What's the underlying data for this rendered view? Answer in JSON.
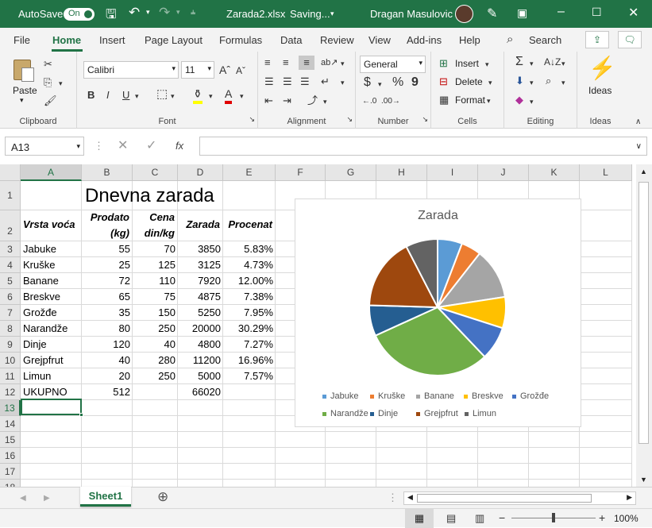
{
  "titlebar": {
    "autosave": "AutoSave",
    "toggle": "On",
    "filename": "Zarada2.xlsx",
    "status": "Saving...",
    "user": "Dragan Masulovic"
  },
  "tabs": [
    "File",
    "Home",
    "Insert",
    "Page Layout",
    "Formulas",
    "Data",
    "Review",
    "View",
    "Add-ins",
    "Help"
  ],
  "search": "Search",
  "ribbon": {
    "clipboard": {
      "paste": "Paste",
      "label": "Clipboard"
    },
    "font": {
      "name": "Calibri",
      "size": "11",
      "label": "Font",
      "grow": "A^",
      "shrink": "Aˇ",
      "bold": "B",
      "italic": "I",
      "underline": "U"
    },
    "alignment": {
      "label": "Alignment"
    },
    "number": {
      "format": "General",
      "label": "Number",
      "currency": "$",
      "percent": "%",
      "comma": "9"
    },
    "cells": {
      "insert": "Insert",
      "delete": "Delete",
      "format": "Format",
      "label": "Cells"
    },
    "editing": {
      "label": "Editing"
    },
    "ideas": {
      "btn": "Ideas",
      "label": "Ideas"
    }
  },
  "formula": {
    "namebox": "A13",
    "fx": "fx",
    "value": ""
  },
  "columns": [
    "A",
    "B",
    "C",
    "D",
    "E",
    "F",
    "G",
    "H",
    "I",
    "J",
    "K",
    "L"
  ],
  "rows": [
    "1",
    "2",
    "3",
    "4",
    "5",
    "6",
    "7",
    "8",
    "9",
    "10",
    "11",
    "12",
    "13",
    "14",
    "15",
    "16",
    "17",
    "18"
  ],
  "sheet": {
    "title": "Dnevna zarada",
    "headers": {
      "a": "Vrsta voća",
      "b1": "Prodato",
      "b2": "(kg)",
      "c1": "Cena",
      "c2": "din/kg",
      "d": "Zarada",
      "e": "Procenat"
    },
    "data": [
      [
        "Jabuke",
        "55",
        "70",
        "3850",
        "5.83%"
      ],
      [
        "Kruške",
        "25",
        "125",
        "3125",
        "4.73%"
      ],
      [
        "Banane",
        "72",
        "110",
        "7920",
        "12.00%"
      ],
      [
        "Breskve",
        "65",
        "75",
        "4875",
        "7.38%"
      ],
      [
        "Grožđe",
        "35",
        "150",
        "5250",
        "7.95%"
      ],
      [
        "Narandže",
        "80",
        "250",
        "20000",
        "30.29%"
      ],
      [
        "Dinje",
        "120",
        "40",
        "4800",
        "7.27%"
      ],
      [
        "Grejpfrut",
        "40",
        "280",
        "11200",
        "16.96%"
      ],
      [
        "Limun",
        "20",
        "250",
        "5000",
        "7.57%"
      ]
    ],
    "total": [
      "UKUPNO",
      "512",
      "",
      "66020",
      ""
    ]
  },
  "sheet_tab": "Sheet1",
  "zoom": "100%",
  "chart_data": {
    "type": "pie",
    "title": "Zarada",
    "categories": [
      "Jabuke",
      "Kruške",
      "Banane",
      "Breskve",
      "Grožđe",
      "Narandže",
      "Dinje",
      "Grejpfrut",
      "Limun"
    ],
    "values": [
      3850,
      3125,
      7920,
      4875,
      5250,
      20000,
      4800,
      11200,
      5000
    ],
    "colors": [
      "#5b9bd5",
      "#ed7d31",
      "#a5a5a5",
      "#ffc000",
      "#4472c4",
      "#70ad47",
      "#255e91",
      "#9e480e",
      "#636363"
    ],
    "legend": "bottom"
  }
}
